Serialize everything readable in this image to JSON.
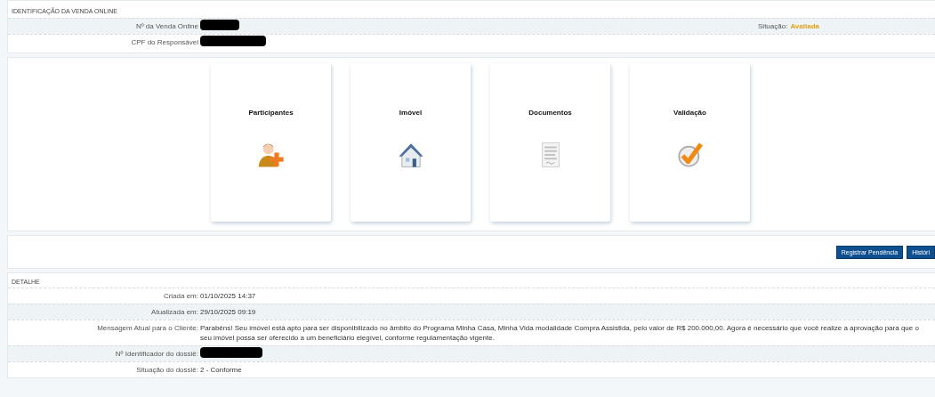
{
  "identification": {
    "title": "IDENTIFICAÇÃO DA VENDA ONLINE",
    "rows": [
      {
        "label": "Nº da Venda Online",
        "redacted": true
      },
      {
        "label": "CPF do Responsável",
        "redacted": true
      }
    ],
    "status": {
      "label": "Situação:",
      "value": "Avaliada"
    }
  },
  "cards": [
    {
      "label": "Participantes",
      "kind": "person"
    },
    {
      "label": "Imóvel",
      "kind": "house"
    },
    {
      "label": "Documentos",
      "kind": "document"
    },
    {
      "label": "Validação",
      "kind": "check"
    }
  ],
  "actions": [
    "Registrar Pendência",
    "Históri"
  ],
  "detail": {
    "title": "DETALHE",
    "rows": [
      {
        "label": "Criada em:",
        "value": "01/10/2025 14:37",
        "redacted": false
      },
      {
        "label": "Atualizada em:",
        "value": "29/10/2025 09:19",
        "redacted": false
      },
      {
        "label": "Mensagem Atual para o Cliente:",
        "value": "Parabéns! Seu imóvel está apto para ser disponibilizado no âmbito do Programa Minha Casa, Minha Vida modalidade Compra Assistida, pelo valor de R$ 200.000,00. Agora é necessário que você realize a aprovação para que o seu imóvel possa ser oferecido a um beneficiário elegível, conforme regulamentação vigente.",
        "redacted": false
      },
      {
        "label": "Nº Identificador do dossiê:",
        "redacted": true
      },
      {
        "label": "Situação do dossiê:",
        "value": "2 - Conforme",
        "redacted": false
      }
    ]
  }
}
